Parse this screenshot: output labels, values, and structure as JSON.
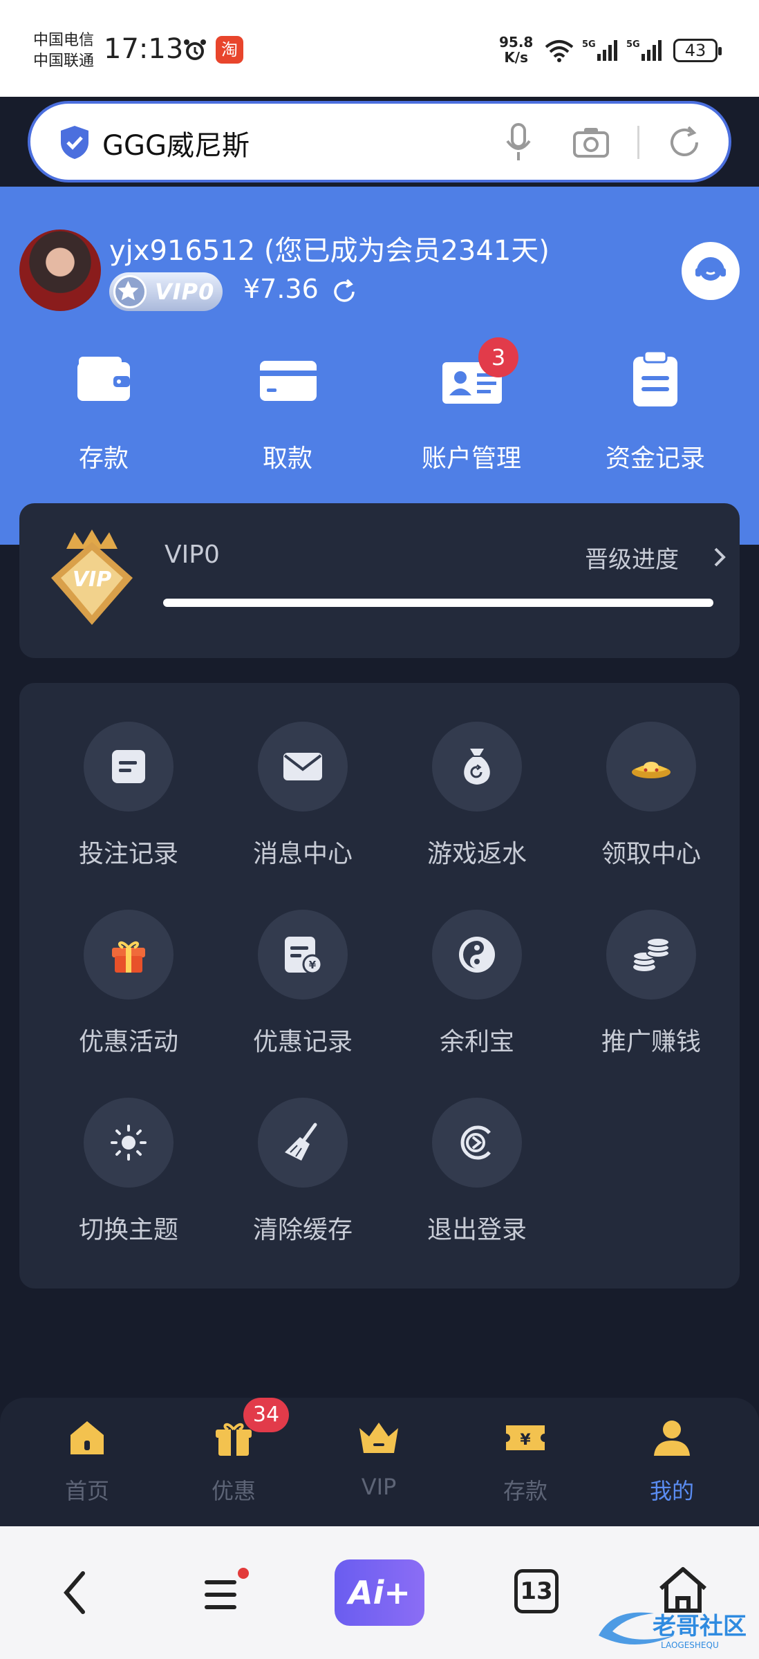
{
  "status_bar": {
    "carrier1": "中国电信",
    "carrier2": "中国联通",
    "time": "17:13",
    "taobao_glyph": "淘",
    "speed_value": "95.8",
    "speed_unit": "K/s",
    "battery": "43"
  },
  "browser": {
    "search_text": "GGG威尼斯"
  },
  "profile": {
    "username": "yjx916512 (您已成为会员2341天)",
    "vip_badge": "VIP0",
    "balance": "¥7.36"
  },
  "quick_actions": [
    {
      "label": "存款",
      "icon": "wallet-icon"
    },
    {
      "label": "取款",
      "icon": "card-icon"
    },
    {
      "label": "账户管理",
      "icon": "id-card-icon",
      "badge": "3"
    },
    {
      "label": "资金记录",
      "icon": "clipboard-icon"
    }
  ],
  "vip_card": {
    "crest_text": "VIP",
    "level": "VIP0",
    "progress_label": "晋级进度",
    "progress": 1.0
  },
  "menu": [
    {
      "label": "投注记录",
      "icon": "bet-record-icon"
    },
    {
      "label": "消息中心",
      "icon": "envelope-icon"
    },
    {
      "label": "游戏返水",
      "icon": "money-bag-icon"
    },
    {
      "label": "领取中心",
      "icon": "gold-ingot-icon"
    },
    {
      "label": "优惠活动",
      "icon": "gift-box-icon"
    },
    {
      "label": "优惠记录",
      "icon": "yen-document-icon"
    },
    {
      "label": "余利宝",
      "icon": "yin-yang-icon"
    },
    {
      "label": "推广赚钱",
      "icon": "coin-stack-icon"
    },
    {
      "label": "切换主题",
      "icon": "sun-icon"
    },
    {
      "label": "清除缓存",
      "icon": "broom-icon"
    },
    {
      "label": "退出登录",
      "icon": "logout-icon"
    }
  ],
  "tabs": [
    {
      "label": "首页",
      "icon": "home-icon"
    },
    {
      "label": "优惠",
      "icon": "gift-icon",
      "badge": "34"
    },
    {
      "label": "VIP",
      "icon": "crown-icon"
    },
    {
      "label": "存款",
      "icon": "ticket-icon"
    },
    {
      "label": "我的",
      "icon": "user-icon",
      "active": true
    }
  ],
  "nav": {
    "ai_label": "Ai+",
    "tab_count": "13"
  },
  "colors": {
    "header_blue": "#4f7fe6",
    "page_dark": "#171c2b",
    "card_dark": "#232a3b",
    "active_tab": "#5a8cf2",
    "badge_red": "#e23b4a"
  }
}
